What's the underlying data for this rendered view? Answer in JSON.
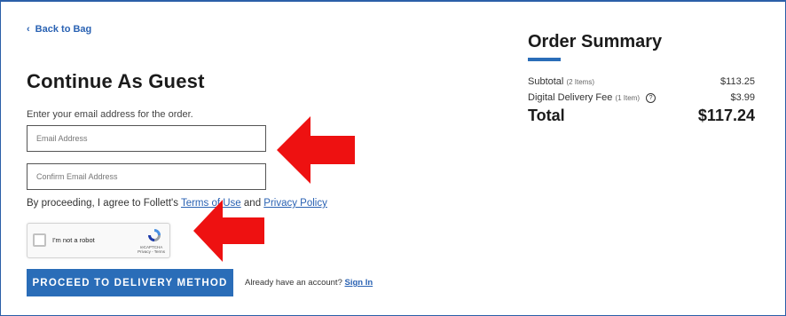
{
  "back_link": {
    "label": "Back to Bag"
  },
  "guest": {
    "title": "Continue As Guest",
    "instruction": "Enter your email address for the order.",
    "email_placeholder": "Email Address",
    "confirm_placeholder": "Confirm Email Address",
    "agree_prefix": "By proceeding, I agree to Follett's ",
    "terms_link": "Terms of Use",
    "agree_and": " and ",
    "privacy_link": "Privacy Policy"
  },
  "captcha": {
    "label": "I'm not a robot",
    "brand": "reCAPTCHA",
    "links": "Privacy - Terms"
  },
  "proceed_button": {
    "label": "PROCEED TO DELIVERY METHOD"
  },
  "account": {
    "prompt": "Already have an account?",
    "sign_in": "Sign In"
  },
  "summary": {
    "title": "Order Summary",
    "subtotal_label": "Subtotal",
    "subtotal_items": "(2 Items)",
    "subtotal_value": "$113.25",
    "fee_label": "Digital Delivery Fee",
    "fee_items": "(1 Item)",
    "fee_value": "$3.99",
    "total_label": "Total",
    "total_value": "$117.24"
  },
  "colors": {
    "accent": "#2a6db8",
    "link": "#2a62b3",
    "annotation_arrow": "#ee1111"
  },
  "icons": {
    "back": "chevron-left-icon",
    "help": "help-circle-icon",
    "recaptcha": "recaptcha-logo-icon"
  }
}
